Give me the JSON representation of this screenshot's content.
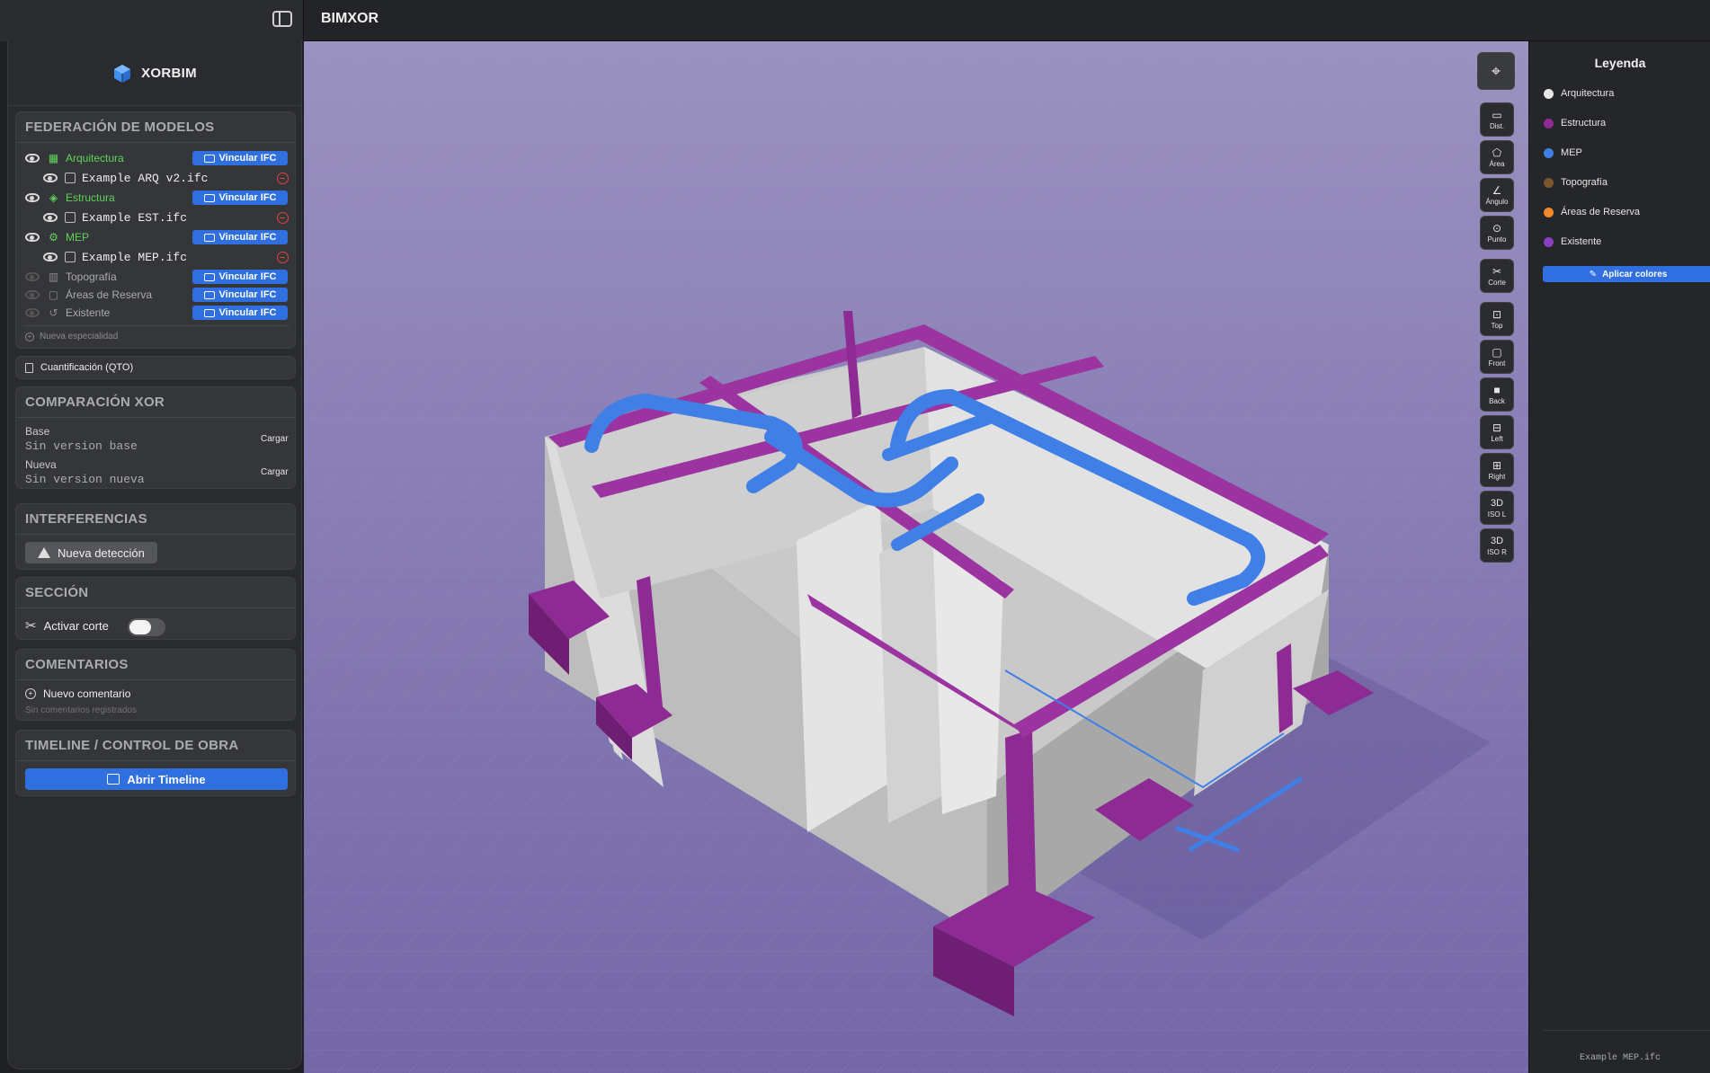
{
  "topbar": {
    "title": "BIMXOR"
  },
  "brand": {
    "name": "XORBIM"
  },
  "federation": {
    "heading": "FEDERACIÓN DE MODELOS",
    "link_label": "Vincular IFC",
    "specialties": [
      {
        "label": "Arquitectura",
        "active": true,
        "file": "Example ARQ v2.ifc"
      },
      {
        "label": "Estructura",
        "active": true,
        "file": "Example EST.ifc"
      },
      {
        "label": "MEP",
        "active": true,
        "file": "Example MEP.ifc"
      },
      {
        "label": "Topografía",
        "active": false
      },
      {
        "label": "Áreas de Reserva",
        "active": false
      },
      {
        "label": "Existente",
        "active": false
      }
    ],
    "new_specialty": "Nueva especialidad"
  },
  "qto": {
    "label": "Cuantificación (QTO)"
  },
  "comparison": {
    "heading": "COMPARACIÓN XOR",
    "base_label": "Base",
    "base_value": "Sin version base",
    "new_label": "Nueva",
    "new_value": "Sin version nueva",
    "load_label": "Cargar"
  },
  "interferences": {
    "heading": "INTERFERENCIAS",
    "button": "Nueva detección"
  },
  "section": {
    "heading": "SECCIÓN",
    "toggle_label": "Activar corte",
    "enabled": false
  },
  "comments": {
    "heading": "COMENTARIOS",
    "new": "Nuevo comentario",
    "empty": "Sin comentarios registrados"
  },
  "timeline": {
    "heading": "TIMELINE / CONTROL DE OBRA",
    "button": "Abrir Timeline"
  },
  "tools": {
    "dist": "Dist.",
    "area": "Área",
    "angle": "Ángulo",
    "point": "Punto",
    "cut": "Corte",
    "top": "Top",
    "front": "Front",
    "back": "Back",
    "left": "Left",
    "right": "Right",
    "iso_l_top": "3D",
    "iso_l": "ISO L",
    "iso_r_top": "3D",
    "iso_r": "ISO R"
  },
  "legend": {
    "title": "Leyenda",
    "items": [
      {
        "label": "Arquitectura",
        "color": "#e8e8e8"
      },
      {
        "label": "Estructura",
        "color": "#8e2a93"
      },
      {
        "label": "MEP",
        "color": "#3f7fe6"
      },
      {
        "label": "Topografía",
        "color": "#7a5630"
      },
      {
        "label": "Áreas de Reserva",
        "color": "#f0892a"
      },
      {
        "label": "Existente",
        "color": "#8a3fc0"
      }
    ],
    "apply_button": "Aplicar colores",
    "active_file": "Example MEP.ifc"
  },
  "colors": {
    "accent": "#2f6fe0",
    "green": "#5fd35a",
    "structure": "#8e2a93",
    "mep": "#3f7fe6",
    "wall": "#d6d6d6"
  }
}
